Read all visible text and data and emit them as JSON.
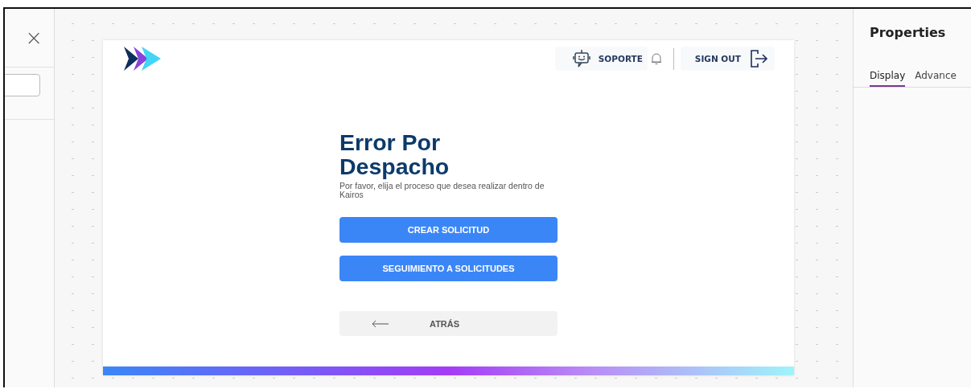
{
  "left_panel": {
    "close": "×"
  },
  "header": {
    "support": "SOPORTE",
    "sign_out": "SIGN OUT"
  },
  "screen": {
    "title": "Error Por Despacho",
    "subtitle": "Por favor, elija el proceso que desea realizar dentro de Kairos",
    "buttons": [
      {
        "label": "CREAR SOLICITUD",
        "kind": "primary"
      },
      {
        "label": "SEGUIMIENTO A SOLICITUDES",
        "kind": "primary"
      },
      {
        "label": "ATRÁS",
        "kind": "back"
      }
    ]
  },
  "properties": {
    "title": "Properties",
    "tabs": [
      {
        "label": "Display",
        "selected": true
      },
      {
        "label": "Advance",
        "selected": false
      }
    ]
  }
}
